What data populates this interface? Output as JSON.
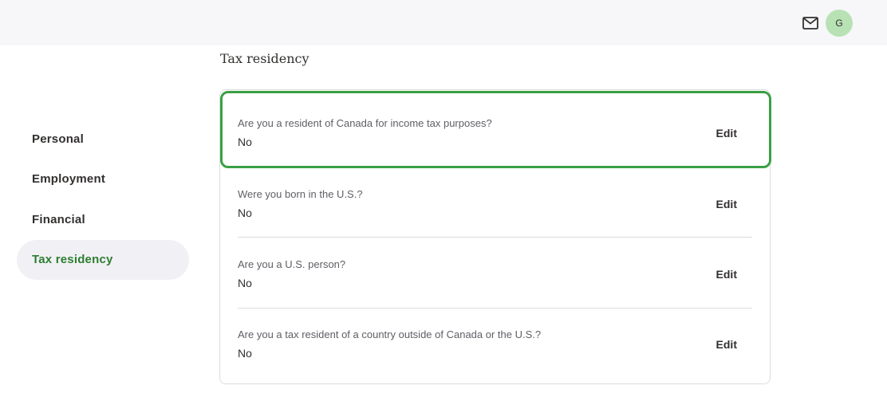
{
  "header": {
    "mail_icon": "mail-icon",
    "avatar_initial": "G",
    "avatar_color": "#b8e2b4"
  },
  "sidebar": {
    "items": [
      {
        "label": "Personal",
        "active": false
      },
      {
        "label": "Employment",
        "active": false
      },
      {
        "label": "Financial",
        "active": false
      },
      {
        "label": "Tax residency",
        "active": true
      }
    ],
    "active_color": "#2e7d32"
  },
  "main": {
    "title": "Tax residency",
    "rows": [
      {
        "question": "Are you a resident of Canada for income tax purposes?",
        "answer": "No",
        "action": "Edit"
      },
      {
        "question": "Were you born in the U.S.?",
        "answer": "No",
        "action": "Edit"
      },
      {
        "question": "Are you a U.S. person?",
        "answer": "No",
        "action": "Edit"
      },
      {
        "question": "Are you a tax resident of a country outside of Canada or the U.S.?",
        "answer": "No",
        "action": "Edit"
      }
    ],
    "focus_color": "#3aa045"
  }
}
